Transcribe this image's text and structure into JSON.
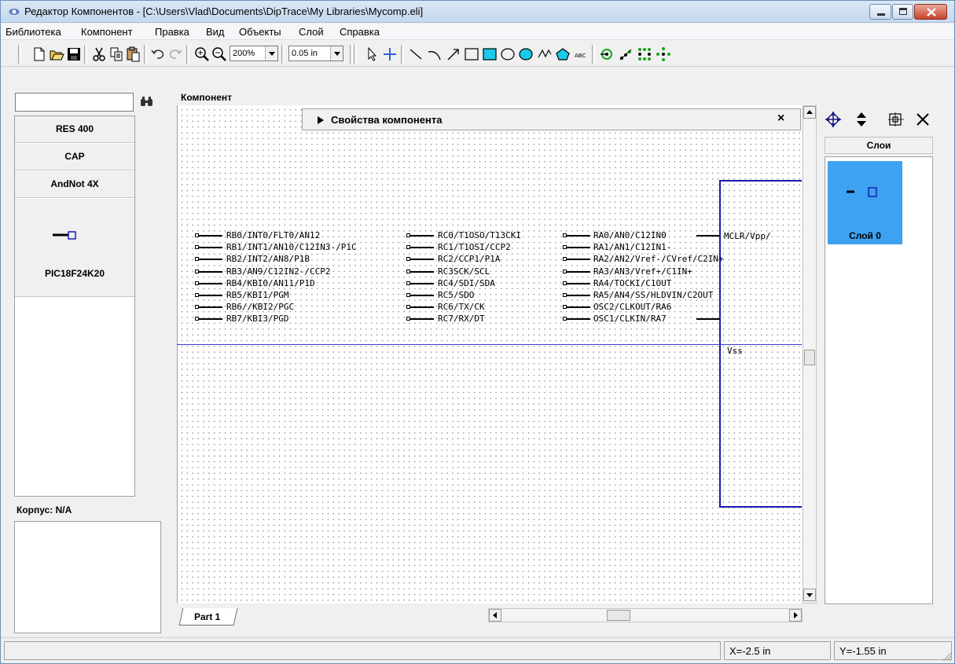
{
  "window": {
    "title": "Редактор Компонентов - [C:\\Users\\Vlad\\Documents\\DipTrace\\My Libraries\\Mycomp.eli]"
  },
  "menu": [
    "Библиотека",
    "Компонент",
    "Правка",
    "Вид",
    "Объекты",
    "Слой",
    "Справка"
  ],
  "toolbar": {
    "zoom": "200%",
    "grid": "0.05 in"
  },
  "library": {
    "search_value": "",
    "items": [
      "RES 400",
      "CAP",
      "AndNot 4X",
      "PIC18F24K20"
    ],
    "selected_index": 3,
    "package_label": "Корпус: N/A"
  },
  "canvas": {
    "group_title": "Компонент",
    "props_header": "Свойства компонента",
    "tab": "Part 1"
  },
  "pins": {
    "col1": [
      "RB0/INT0/FLT0/AN12",
      "RB1/INT1/AN10/C12IN3-/P1C",
      "RB2/INT2/AN8/P1B",
      "RB3/AN9/C12IN2-/CCP2",
      "RB4/KBI0/AN11/P1D",
      "RB5/KBI1/PGM",
      "RB6//KBI2/PGC",
      "RB7/KBI3/PGD"
    ],
    "col2": [
      "RC0/T1OSO/T13CKI",
      "RC1/T1OSI/CCP2",
      "RC2/CCP1/P1A",
      "RC3SCK/SCL",
      "RC4/SDI/SDA",
      "RC5/SDO",
      "RC6/TX/CK",
      "RC7/RX/DT"
    ],
    "col3": [
      "RA0/AN0/C12IN0",
      "RA1/AN1/C12IN1-",
      "RA2/AN2/Vref-/CVref/C2IN+",
      "RA3/AN3/Vref+/C1IN+",
      "RA4/TOCKI/C1OUT",
      "RA5/AN4/SS/HLDVIN/C2OUT",
      "OSC2/CLKOUT/RA6",
      "OSC1/CLKIN/RA7"
    ],
    "right_labels": [
      "MCLR/Vpp/",
      "Vss"
    ]
  },
  "layers": {
    "title": "Слои",
    "items": [
      "Слой 0"
    ]
  },
  "status": {
    "x": "X=-2.5 in",
    "y": "Y=-1.55 in"
  },
  "colors": {
    "outline_blue": "#1a1ab0",
    "layer_selected": "#3ea2f2"
  }
}
